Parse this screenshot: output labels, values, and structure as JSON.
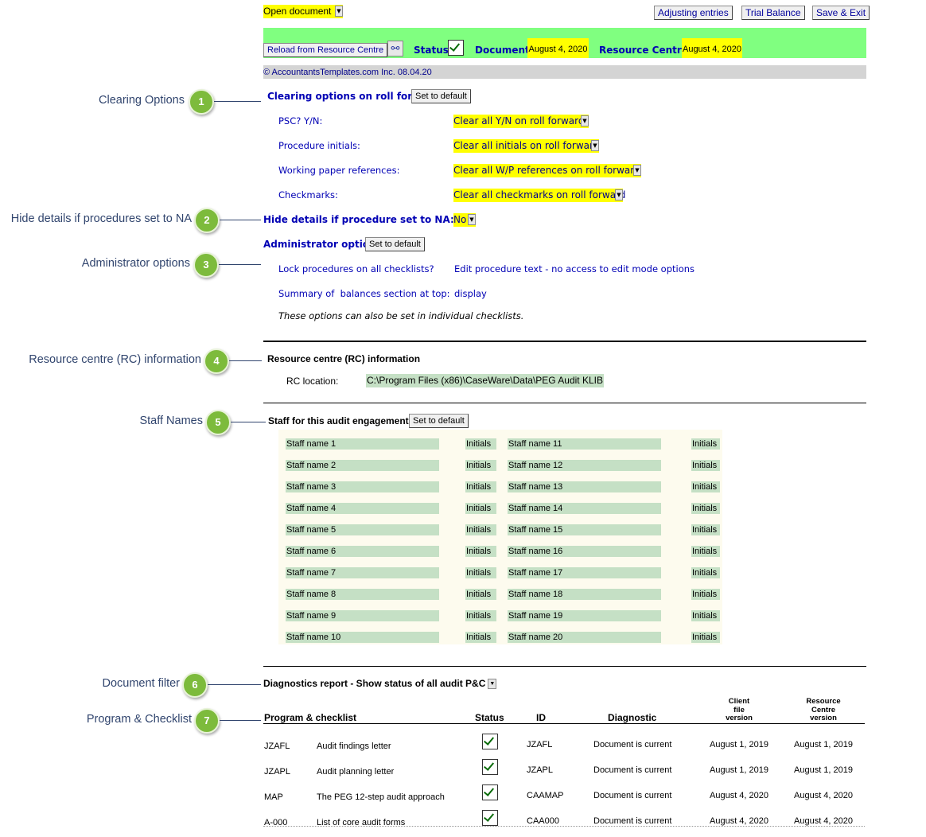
{
  "toolbar": {
    "open_document": "Open document",
    "adjusting_entries": "Adjusting entries",
    "trial_balance": "Trial Balance",
    "save_exit": "Save & Exit"
  },
  "status_bar": {
    "reload_label": "Reload from Resource Centre",
    "status_label": "Status:",
    "document_label": "Document :",
    "document_date": "August 4, 2020",
    "rc_label": "Resource Centre :",
    "rc_date": "August 4, 2020",
    "copyright": "© AccountantsTemplates.com Inc. 08.04.20"
  },
  "callouts": [
    {
      "num": "1",
      "label": "Clearing Options"
    },
    {
      "num": "2",
      "label": "Hide details if procedures set to NA"
    },
    {
      "num": "3",
      "label": "Administrator options"
    },
    {
      "num": "4",
      "label": "Resource centre (RC) information"
    },
    {
      "num": "5",
      "label": "Staff Names"
    },
    {
      "num": "6",
      "label": "Document filter"
    },
    {
      "num": "7",
      "label": "Program & Checklist"
    }
  ],
  "clearing": {
    "title": "Clearing options on roll forward",
    "set_default": "Set to default",
    "items": [
      {
        "label": "PSC? Y/N:",
        "value": "Clear all Y/N on roll forward"
      },
      {
        "label": "Procedure initials:",
        "value": "Clear all initials on roll forward"
      },
      {
        "label": "Working paper references:",
        "value": "Clear all W/P references on roll forward"
      },
      {
        "label": "Checkmarks:",
        "value": "Clear all checkmarks on roll forward"
      }
    ]
  },
  "hide_details": {
    "label": "Hide details if procedure set to NA:",
    "value": "No"
  },
  "admin": {
    "title": "Administrator options",
    "set_default": "Set to default",
    "lock_label": "Lock procedures on all checklists?",
    "lock_value": "Edit procedure text - no access to edit mode options",
    "summary_label": "Summary of  balances section at top:",
    "summary_value": "display",
    "note": "These options can also be set in individual checklists."
  },
  "rc_info": {
    "title": "Resource centre (RC) information",
    "location_label": "RC location:",
    "location_value": "C:\\Program Files (x86)\\CaseWare\\Data\\PEG Audit KLIB"
  },
  "staff": {
    "title": "Staff for this audit engagement",
    "set_default": "Set to default",
    "initials_label": "Initials",
    "left": [
      "Staff name 1",
      "Staff name 2",
      "Staff name 3",
      "Staff name 4",
      "Staff name 5",
      "Staff name 6",
      "Staff name 7",
      "Staff name 8",
      "Staff name 9",
      "Staff name 10"
    ],
    "right": [
      "Staff name 11",
      "Staff name 12",
      "Staff name 13",
      "Staff name 14",
      "Staff name 15",
      "Staff name 16",
      "Staff name 17",
      "Staff name 18",
      "Staff name 19",
      "Staff name 20"
    ]
  },
  "diagnostics": {
    "filter": "Diagnostics report - Show status of all audit P&C",
    "headers": {
      "program": "Program & checklist",
      "status": "Status",
      "id": "ID",
      "diagnostic": "Diagnostic",
      "client_l1": "Client",
      "client_l2": "file",
      "client_l3": "version",
      "rc_l1": "Resource",
      "rc_l2": "Centre",
      "rc_l3": "version"
    },
    "rows": [
      {
        "code": "JZAFL",
        "name": "Audit findings letter",
        "id": "JZAFL",
        "diag": "Document is current",
        "client": "August 1, 2019",
        "rc": "August 1, 2019"
      },
      {
        "code": "JZAPL",
        "name": "Audit planning letter",
        "id": "JZAPL",
        "diag": "Document is current",
        "client": "August 1, 2019",
        "rc": "August 1, 2019"
      },
      {
        "code": "MAP",
        "name": "The PEG 12-step audit approach",
        "id": "CAAMAP",
        "diag": "Document is current",
        "client": "August 4, 2020",
        "rc": "August 4, 2020"
      },
      {
        "code": "A-000",
        "name": "List of core audit forms",
        "id": "CAA000",
        "diag": "Document is current",
        "client": "August 4, 2020",
        "rc": "August 4, 2020"
      }
    ]
  }
}
